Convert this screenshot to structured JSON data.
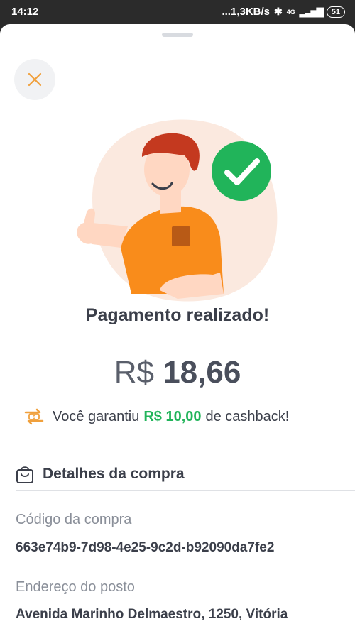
{
  "status_bar": {
    "time": "14:12",
    "network_speed": "...1,3KB/s",
    "network_type": "4G",
    "battery": "51"
  },
  "payment": {
    "title": "Pagamento realizado!",
    "currency": "R$",
    "amount": "18,66",
    "cashback_prefix": "Você garantiu",
    "cashback_amount": "R$ 10,00",
    "cashback_suffix": "de cashback!"
  },
  "details": {
    "header": "Detalhes da compra",
    "code_label": "Código da compra",
    "code_value": "663e74b9-7d98-4e25-9c2d-b92090da7fe2",
    "address_label": "Endereço do posto",
    "address_value": "Avenida Marinho Delmaestro, 1250, Vitória"
  },
  "colors": {
    "accent_orange": "#f0a03c",
    "success_green": "#21b45a",
    "text_dark": "#3b3f4a"
  },
  "icons": {
    "close": "close-icon",
    "success": "check-circle-icon",
    "cashback": "cashback-exchange-icon",
    "bag": "shopping-bag-icon"
  }
}
